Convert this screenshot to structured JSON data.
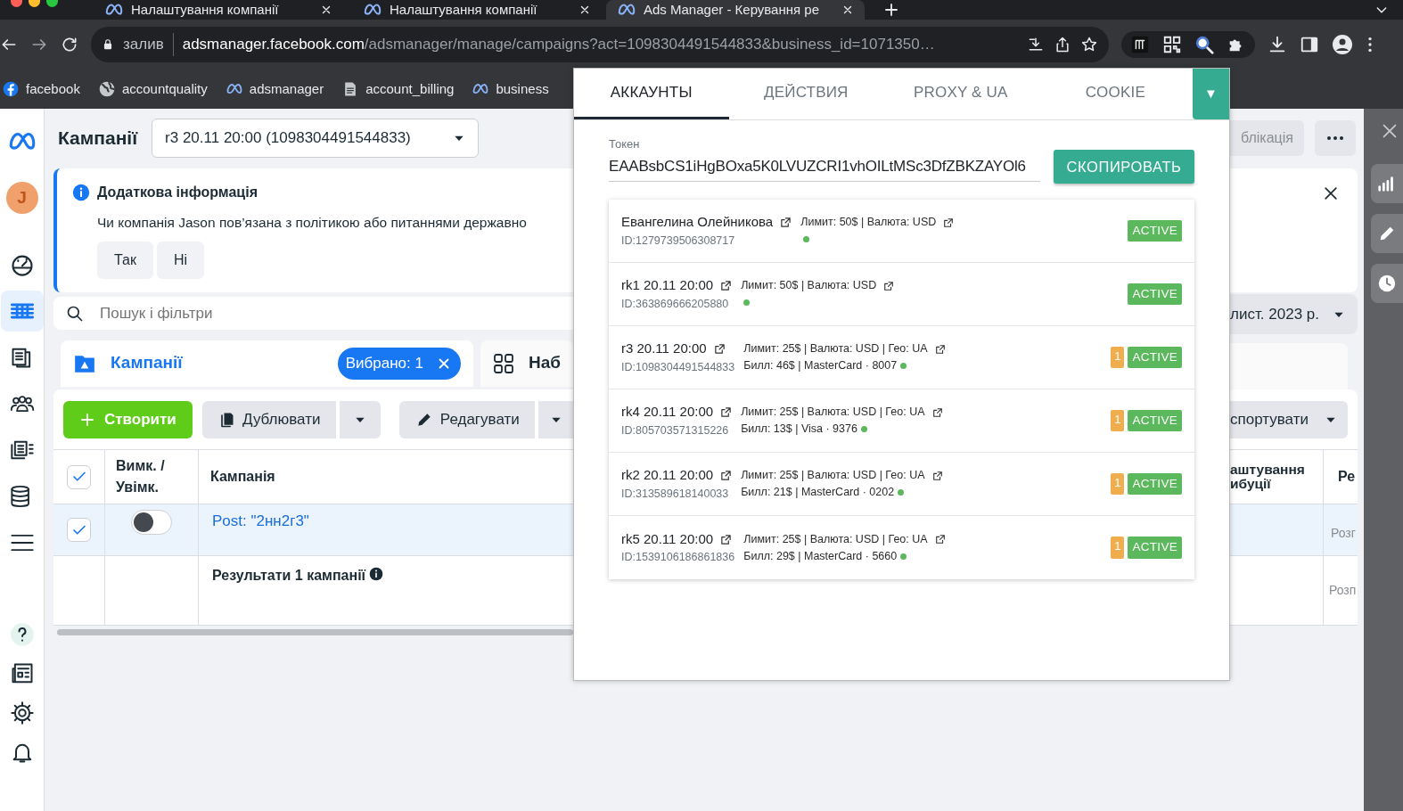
{
  "browser": {
    "tabs": [
      {
        "title": "Налаштування компанії",
        "selected": false
      },
      {
        "title": "Налаштування компанії",
        "selected": false
      },
      {
        "title": "Ads Manager - Керування ре",
        "selected": true
      }
    ],
    "address": {
      "chip": "залив",
      "host": "adsmanager.facebook.com",
      "path": "/adsmanager/manage/campaigns?act=1098304491544833&business_id=1071350…"
    },
    "bookmarks": [
      {
        "kind": "facebook",
        "label": "facebook"
      },
      {
        "kind": "globe",
        "label": "accountquality"
      },
      {
        "kind": "meta",
        "label": "adsmanager"
      },
      {
        "kind": "doc",
        "label": "account_billing"
      },
      {
        "kind": "meta",
        "label": "business"
      }
    ]
  },
  "sidebar": {
    "avatar": "J",
    "items": [
      {
        "kind": "gauge",
        "selected": false
      },
      {
        "kind": "table",
        "selected": true
      },
      {
        "kind": "pages",
        "selected": false
      },
      {
        "kind": "people",
        "selected": false
      },
      {
        "kind": "listdoc",
        "selected": false
      },
      {
        "kind": "coins",
        "selected": false
      },
      {
        "kind": "menu",
        "selected": false
      }
    ],
    "bottom": [
      {
        "kind": "help"
      },
      {
        "kind": "news"
      },
      {
        "kind": "settings"
      },
      {
        "kind": "bell"
      }
    ]
  },
  "page": {
    "title": "Кампанії",
    "account_select": "r3 20.11 20:00 (1098304491544833)",
    "publish_button": "блікація",
    "notice": {
      "title": "Додаткова інформація",
      "text": "Чи компанія Jason пов’язана з політикою або питаннями державно",
      "buttons": [
        "Так",
        "Ні"
      ]
    },
    "search": {
      "placeholder": "Пошук і фільтри"
    },
    "date_range": "лист. 2023 р.",
    "level_tabs": [
      {
        "label": "Кампанії",
        "selected": true,
        "chip": "Вибрано: 1"
      },
      {
        "label": "Наб",
        "selected": false
      }
    ],
    "toolbar": {
      "create": "Створити",
      "duplicate": "Дублювати",
      "edit": "Редагувати",
      "export": "спортувати"
    },
    "table": {
      "columns": [
        "Вимк. / Увімк.",
        "Кампанія",
        "аштування ибуції",
        "Ре"
      ],
      "select_all_checked": true,
      "rows": [
        {
          "checked": true,
          "on": false,
          "selected": true,
          "campaign": "Post: \"2нн2г3\"",
          "column_4": "Розг"
        }
      ],
      "summary": {
        "text": "Результати 1 кампанії",
        "column_4": "Розп"
      }
    }
  },
  "right_panel": {
    "tools": [
      {
        "kind": "chart"
      },
      {
        "kind": "pencil"
      },
      {
        "kind": "clock"
      }
    ]
  },
  "extension": {
    "tabs": [
      {
        "label": "АККАУНТЫ",
        "selected": true
      },
      {
        "label": "ДЕЙСТВИЯ",
        "selected": false
      },
      {
        "label": "PROXY & UA",
        "selected": false
      },
      {
        "label": "COOKIE",
        "selected": false
      }
    ],
    "menu_button": "▼",
    "token": {
      "label": "Токен",
      "value": "EAABsbCS1iHgBOxa5K0LVUZCRI1vhOILtMSc3DfZBKZAYOl6"
    },
    "copy_button": "СКОПИРОВАТЬ",
    "accounts": [
      {
        "name": "Евангелина Олейникова",
        "account_id": "ID:1279739506308717",
        "limits": "Лимит: 50$ | Валюта: USD",
        "status": "ACTIVE"
      },
      {
        "name": "rk1 20.11 20:00",
        "account_id": "ID:363869666205880",
        "limits": "Лимит: 50$ | Валюта: USD",
        "status": "ACTIVE"
      },
      {
        "name": "r3 20.11 20:00",
        "account_id": "ID:1098304491544833",
        "limits": "Лимит: 25$ | Валюта: USD | Гео: UA",
        "billing": "Билл: 46$ | MasterCard · 8007",
        "alerts": "1",
        "status": "ACTIVE"
      },
      {
        "name": "rk4 20.11 20:00",
        "account_id": "ID:805703571315226",
        "limits": "Лимит: 25$ | Валюта: USD | Гео: UA",
        "billing": "Билл: 13$ | Visa · 9376",
        "alerts": "1",
        "status": "ACTIVE"
      },
      {
        "name": "rk2 20.11 20:00",
        "account_id": "ID:313589618140033",
        "limits": "Лимит: 25$ | Валюта: USD | Гео: UA",
        "billing": "Билл: 21$ | MasterCard · 0202",
        "alerts": "1",
        "status": "ACTIVE"
      },
      {
        "name": "rk5 20.11 20:00",
        "account_id": "ID:1539106186861836",
        "limits": "Лимит: 25$ | Валюта: USD | Гео: UA",
        "billing": "Билл: 29$ | MasterCard · 5660",
        "alerts": "1",
        "status": "ACTIVE"
      }
    ]
  }
}
